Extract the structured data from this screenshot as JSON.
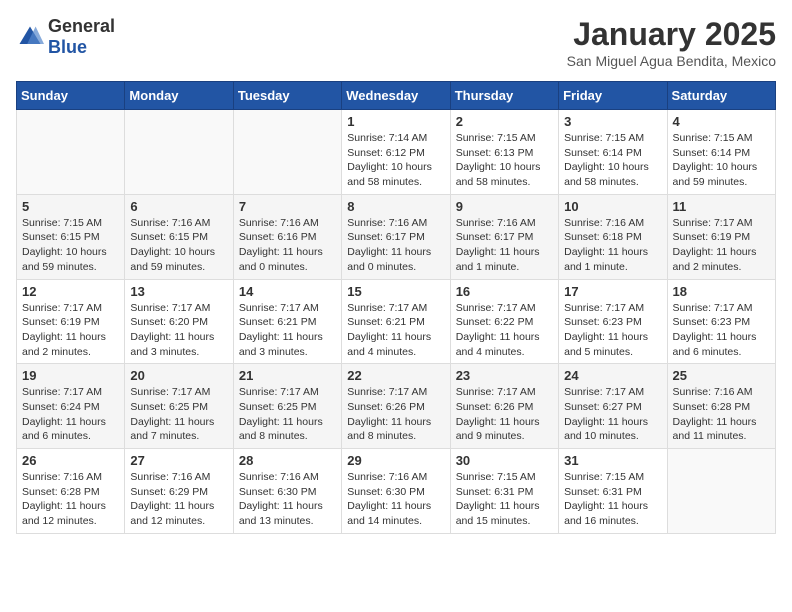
{
  "logo": {
    "general": "General",
    "blue": "Blue"
  },
  "header": {
    "title": "January 2025",
    "subtitle": "San Miguel Agua Bendita, Mexico"
  },
  "days_of_week": [
    "Sunday",
    "Monday",
    "Tuesday",
    "Wednesday",
    "Thursday",
    "Friday",
    "Saturday"
  ],
  "weeks": [
    [
      {
        "day": "",
        "info": ""
      },
      {
        "day": "",
        "info": ""
      },
      {
        "day": "",
        "info": ""
      },
      {
        "day": "1",
        "info": "Sunrise: 7:14 AM\nSunset: 6:12 PM\nDaylight: 10 hours and 58 minutes."
      },
      {
        "day": "2",
        "info": "Sunrise: 7:15 AM\nSunset: 6:13 PM\nDaylight: 10 hours and 58 minutes."
      },
      {
        "day": "3",
        "info": "Sunrise: 7:15 AM\nSunset: 6:14 PM\nDaylight: 10 hours and 58 minutes."
      },
      {
        "day": "4",
        "info": "Sunrise: 7:15 AM\nSunset: 6:14 PM\nDaylight: 10 hours and 59 minutes."
      }
    ],
    [
      {
        "day": "5",
        "info": "Sunrise: 7:15 AM\nSunset: 6:15 PM\nDaylight: 10 hours and 59 minutes."
      },
      {
        "day": "6",
        "info": "Sunrise: 7:16 AM\nSunset: 6:15 PM\nDaylight: 10 hours and 59 minutes."
      },
      {
        "day": "7",
        "info": "Sunrise: 7:16 AM\nSunset: 6:16 PM\nDaylight: 11 hours and 0 minutes."
      },
      {
        "day": "8",
        "info": "Sunrise: 7:16 AM\nSunset: 6:17 PM\nDaylight: 11 hours and 0 minutes."
      },
      {
        "day": "9",
        "info": "Sunrise: 7:16 AM\nSunset: 6:17 PM\nDaylight: 11 hours and 1 minute."
      },
      {
        "day": "10",
        "info": "Sunrise: 7:16 AM\nSunset: 6:18 PM\nDaylight: 11 hours and 1 minute."
      },
      {
        "day": "11",
        "info": "Sunrise: 7:17 AM\nSunset: 6:19 PM\nDaylight: 11 hours and 2 minutes."
      }
    ],
    [
      {
        "day": "12",
        "info": "Sunrise: 7:17 AM\nSunset: 6:19 PM\nDaylight: 11 hours and 2 minutes."
      },
      {
        "day": "13",
        "info": "Sunrise: 7:17 AM\nSunset: 6:20 PM\nDaylight: 11 hours and 3 minutes."
      },
      {
        "day": "14",
        "info": "Sunrise: 7:17 AM\nSunset: 6:21 PM\nDaylight: 11 hours and 3 minutes."
      },
      {
        "day": "15",
        "info": "Sunrise: 7:17 AM\nSunset: 6:21 PM\nDaylight: 11 hours and 4 minutes."
      },
      {
        "day": "16",
        "info": "Sunrise: 7:17 AM\nSunset: 6:22 PM\nDaylight: 11 hours and 4 minutes."
      },
      {
        "day": "17",
        "info": "Sunrise: 7:17 AM\nSunset: 6:23 PM\nDaylight: 11 hours and 5 minutes."
      },
      {
        "day": "18",
        "info": "Sunrise: 7:17 AM\nSunset: 6:23 PM\nDaylight: 11 hours and 6 minutes."
      }
    ],
    [
      {
        "day": "19",
        "info": "Sunrise: 7:17 AM\nSunset: 6:24 PM\nDaylight: 11 hours and 6 minutes."
      },
      {
        "day": "20",
        "info": "Sunrise: 7:17 AM\nSunset: 6:25 PM\nDaylight: 11 hours and 7 minutes."
      },
      {
        "day": "21",
        "info": "Sunrise: 7:17 AM\nSunset: 6:25 PM\nDaylight: 11 hours and 8 minutes."
      },
      {
        "day": "22",
        "info": "Sunrise: 7:17 AM\nSunset: 6:26 PM\nDaylight: 11 hours and 8 minutes."
      },
      {
        "day": "23",
        "info": "Sunrise: 7:17 AM\nSunset: 6:26 PM\nDaylight: 11 hours and 9 minutes."
      },
      {
        "day": "24",
        "info": "Sunrise: 7:17 AM\nSunset: 6:27 PM\nDaylight: 11 hours and 10 minutes."
      },
      {
        "day": "25",
        "info": "Sunrise: 7:16 AM\nSunset: 6:28 PM\nDaylight: 11 hours and 11 minutes."
      }
    ],
    [
      {
        "day": "26",
        "info": "Sunrise: 7:16 AM\nSunset: 6:28 PM\nDaylight: 11 hours and 12 minutes."
      },
      {
        "day": "27",
        "info": "Sunrise: 7:16 AM\nSunset: 6:29 PM\nDaylight: 11 hours and 12 minutes."
      },
      {
        "day": "28",
        "info": "Sunrise: 7:16 AM\nSunset: 6:30 PM\nDaylight: 11 hours and 13 minutes."
      },
      {
        "day": "29",
        "info": "Sunrise: 7:16 AM\nSunset: 6:30 PM\nDaylight: 11 hours and 14 minutes."
      },
      {
        "day": "30",
        "info": "Sunrise: 7:15 AM\nSunset: 6:31 PM\nDaylight: 11 hours and 15 minutes."
      },
      {
        "day": "31",
        "info": "Sunrise: 7:15 AM\nSunset: 6:31 PM\nDaylight: 11 hours and 16 minutes."
      },
      {
        "day": "",
        "info": ""
      }
    ]
  ]
}
